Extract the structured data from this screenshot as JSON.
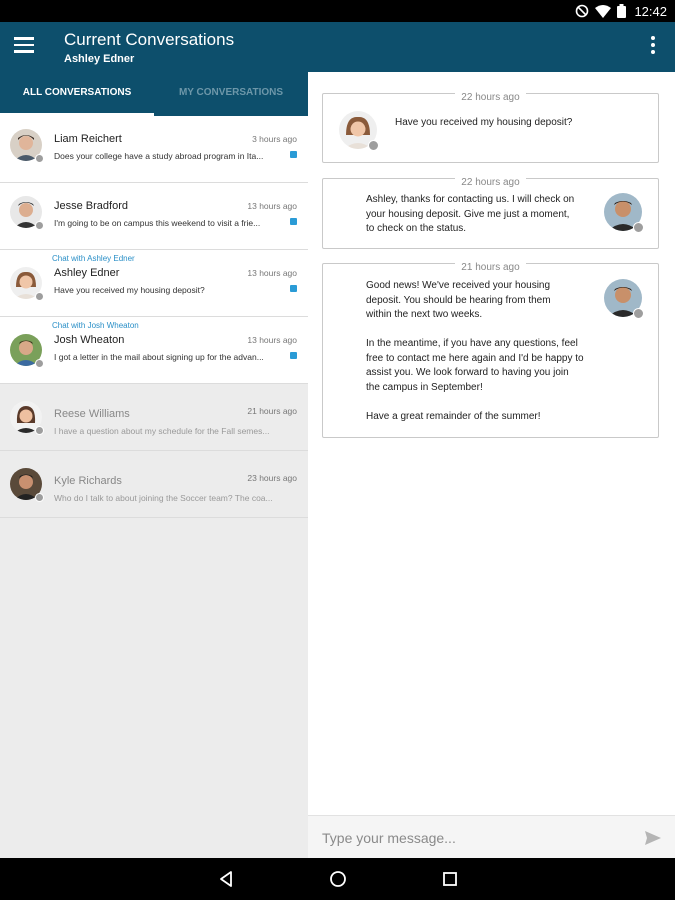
{
  "status_bar": {
    "time": "12:42",
    "icons": [
      "dnd-icon",
      "wifi-icon",
      "battery-icon"
    ]
  },
  "app_bar": {
    "title": "Current Conversations",
    "subtitle": "Ashley Edner",
    "menu_icon": "hamburger-menu-icon",
    "overflow_icon": "more-vert-icon"
  },
  "tabs": [
    {
      "label": "ALL CONVERSATIONS",
      "active": true
    },
    {
      "label": "MY CONVERSATIONS",
      "active": false
    }
  ],
  "conversations": [
    {
      "chat_with": "",
      "name": "Liam Reichert",
      "time": "3 hours ago",
      "preview": "Does your college have a study abroad program in Ita...",
      "unread": true
    },
    {
      "chat_with": "",
      "name": "Jesse Bradford",
      "time": "13 hours ago",
      "preview": "I'm going to be on campus this weekend to visit a frie...",
      "unread": true
    },
    {
      "chat_with": "Chat with Ashley Edner",
      "name": "Ashley Edner",
      "time": "13 hours ago",
      "preview": "Have you received my housing deposit?",
      "unread": true
    },
    {
      "chat_with": "Chat with Josh Wheaton",
      "name": "Josh Wheaton",
      "time": "13 hours ago",
      "preview": "I got a letter in the mail about signing up for the advan...",
      "unread": true
    },
    {
      "chat_with": "",
      "name": "Reese Williams",
      "time": "21 hours ago",
      "preview": "I have a question about my schedule for the Fall semes...",
      "unread": false
    },
    {
      "chat_with": "",
      "name": "Kyle Richards",
      "time": "23 hours ago",
      "preview": "Who do I talk to about joining the Soccer team? The coa...",
      "unread": false
    }
  ],
  "messages": [
    {
      "time": "22 hours ago",
      "sender": "incoming",
      "paragraphs": [
        "Have you received my housing deposit?"
      ]
    },
    {
      "time": "22 hours ago",
      "sender": "outgoing",
      "paragraphs": [
        "Ashley, thanks for contacting us. I will check on",
        "your housing deposit.  Give me just a moment,",
        "to check on the status."
      ]
    },
    {
      "time": "21 hours ago",
      "sender": "outgoing",
      "paragraphs": [
        "Good news!  We've received your housing",
        "deposit. You should be hearing from them",
        "within the next two weeks.",
        "",
        "In the meantime, if you have any questions, feel",
        "free to contact me here again and I'd be happy to",
        "assist you.  We look forward to having you join",
        "the campus in September!",
        "",
        "Have a great remainder of the summer!"
      ]
    }
  ],
  "composer": {
    "placeholder": "Type your message...",
    "send_icon": "send-icon"
  },
  "nav_bar": {
    "icons": [
      "back-icon",
      "home-icon",
      "recents-icon"
    ]
  },
  "colors": {
    "primary": "#0d4f6c",
    "accent": "#2a9bd6",
    "list_bg": "#ececec"
  }
}
